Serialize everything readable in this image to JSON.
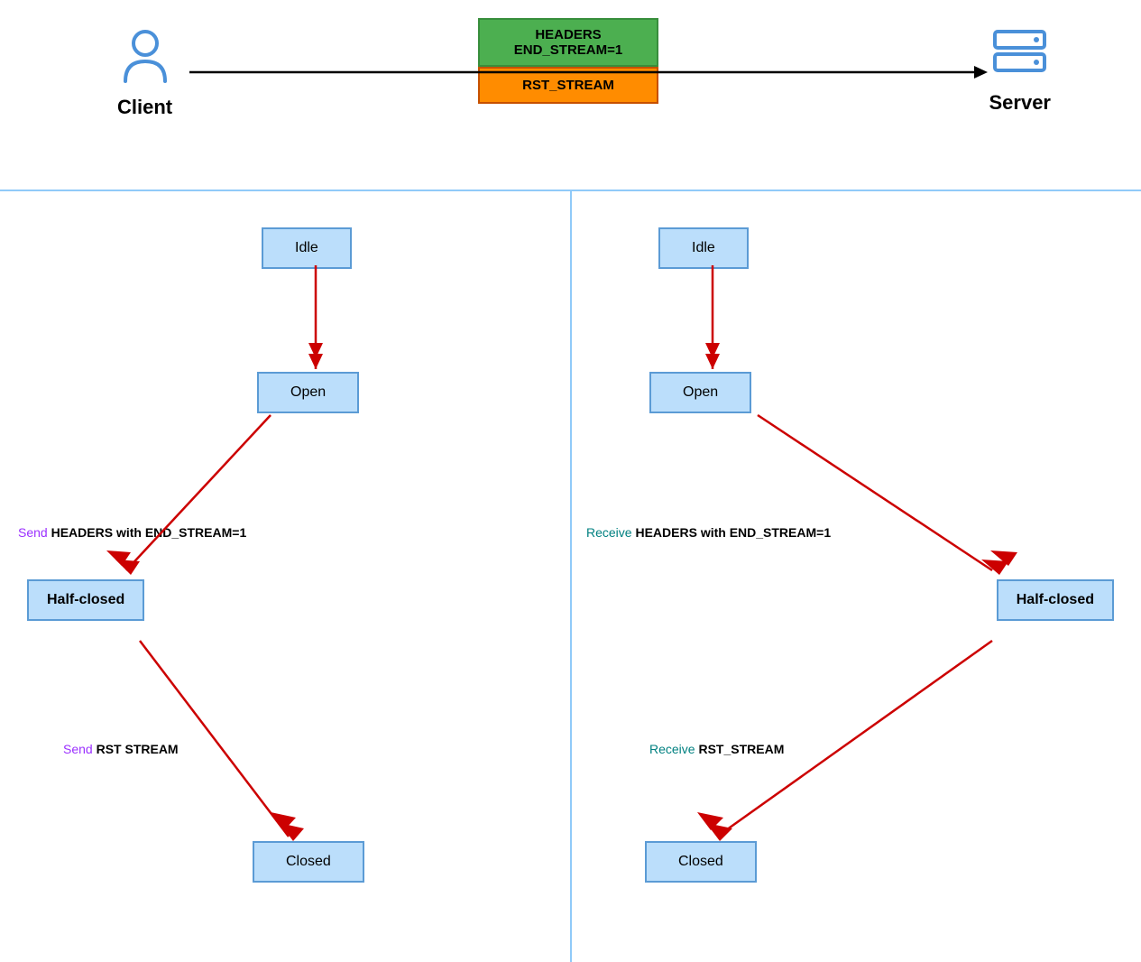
{
  "header": {
    "client_label": "Client",
    "server_label": "Server",
    "msg_green_line1": "HEADERS",
    "msg_green_line2": "END_STREAM=1",
    "msg_orange": "RST_STREAM"
  },
  "client_states": {
    "idle": "Idle",
    "open": "Open",
    "half_closed": "Half-closed",
    "closed": "Closed"
  },
  "server_states": {
    "idle": "Idle",
    "open": "Open",
    "half_closed": "Half-closed",
    "closed": "Closed"
  },
  "transitions": {
    "client_to_half_closed_prefix": "Send ",
    "client_to_half_closed_bold": "HEADERS with END_STREAM=1",
    "client_to_closed_prefix": "Send ",
    "client_to_closed_bold": "RST STREAM",
    "server_to_half_closed_prefix": "Receive ",
    "server_to_half_closed_bold": "HEADERS with END_STREAM=1",
    "server_to_closed_prefix": "Receive ",
    "server_to_closed_bold": "RST_STREAM"
  },
  "colors": {
    "arrow_red": "#CC0000",
    "state_fill": "#BBDEFB",
    "state_border": "#5B9BD5",
    "divider": "#90CAF9",
    "green_box": "#4CAF50",
    "orange_box": "#FF8C00",
    "label_purple": "#9B30FF",
    "label_teal": "#008080"
  }
}
